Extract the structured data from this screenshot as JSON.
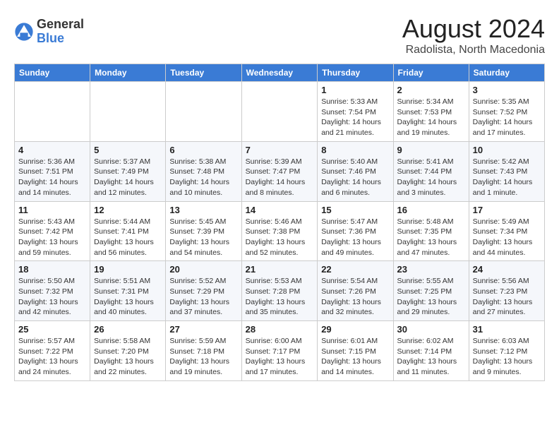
{
  "logo": {
    "general": "General",
    "blue": "Blue"
  },
  "title": "August 2024",
  "location": "Radolista, North Macedonia",
  "days_of_week": [
    "Sunday",
    "Monday",
    "Tuesday",
    "Wednesday",
    "Thursday",
    "Friday",
    "Saturday"
  ],
  "weeks": [
    [
      {
        "day": "",
        "detail": ""
      },
      {
        "day": "",
        "detail": ""
      },
      {
        "day": "",
        "detail": ""
      },
      {
        "day": "",
        "detail": ""
      },
      {
        "day": "1",
        "detail": "Sunrise: 5:33 AM\nSunset: 7:54 PM\nDaylight: 14 hours and 21 minutes."
      },
      {
        "day": "2",
        "detail": "Sunrise: 5:34 AM\nSunset: 7:53 PM\nDaylight: 14 hours and 19 minutes."
      },
      {
        "day": "3",
        "detail": "Sunrise: 5:35 AM\nSunset: 7:52 PM\nDaylight: 14 hours and 17 minutes."
      }
    ],
    [
      {
        "day": "4",
        "detail": "Sunrise: 5:36 AM\nSunset: 7:51 PM\nDaylight: 14 hours and 14 minutes."
      },
      {
        "day": "5",
        "detail": "Sunrise: 5:37 AM\nSunset: 7:49 PM\nDaylight: 14 hours and 12 minutes."
      },
      {
        "day": "6",
        "detail": "Sunrise: 5:38 AM\nSunset: 7:48 PM\nDaylight: 14 hours and 10 minutes."
      },
      {
        "day": "7",
        "detail": "Sunrise: 5:39 AM\nSunset: 7:47 PM\nDaylight: 14 hours and 8 minutes."
      },
      {
        "day": "8",
        "detail": "Sunrise: 5:40 AM\nSunset: 7:46 PM\nDaylight: 14 hours and 6 minutes."
      },
      {
        "day": "9",
        "detail": "Sunrise: 5:41 AM\nSunset: 7:44 PM\nDaylight: 14 hours and 3 minutes."
      },
      {
        "day": "10",
        "detail": "Sunrise: 5:42 AM\nSunset: 7:43 PM\nDaylight: 14 hours and 1 minute."
      }
    ],
    [
      {
        "day": "11",
        "detail": "Sunrise: 5:43 AM\nSunset: 7:42 PM\nDaylight: 13 hours and 59 minutes."
      },
      {
        "day": "12",
        "detail": "Sunrise: 5:44 AM\nSunset: 7:41 PM\nDaylight: 13 hours and 56 minutes."
      },
      {
        "day": "13",
        "detail": "Sunrise: 5:45 AM\nSunset: 7:39 PM\nDaylight: 13 hours and 54 minutes."
      },
      {
        "day": "14",
        "detail": "Sunrise: 5:46 AM\nSunset: 7:38 PM\nDaylight: 13 hours and 52 minutes."
      },
      {
        "day": "15",
        "detail": "Sunrise: 5:47 AM\nSunset: 7:36 PM\nDaylight: 13 hours and 49 minutes."
      },
      {
        "day": "16",
        "detail": "Sunrise: 5:48 AM\nSunset: 7:35 PM\nDaylight: 13 hours and 47 minutes."
      },
      {
        "day": "17",
        "detail": "Sunrise: 5:49 AM\nSunset: 7:34 PM\nDaylight: 13 hours and 44 minutes."
      }
    ],
    [
      {
        "day": "18",
        "detail": "Sunrise: 5:50 AM\nSunset: 7:32 PM\nDaylight: 13 hours and 42 minutes."
      },
      {
        "day": "19",
        "detail": "Sunrise: 5:51 AM\nSunset: 7:31 PM\nDaylight: 13 hours and 40 minutes."
      },
      {
        "day": "20",
        "detail": "Sunrise: 5:52 AM\nSunset: 7:29 PM\nDaylight: 13 hours and 37 minutes."
      },
      {
        "day": "21",
        "detail": "Sunrise: 5:53 AM\nSunset: 7:28 PM\nDaylight: 13 hours and 35 minutes."
      },
      {
        "day": "22",
        "detail": "Sunrise: 5:54 AM\nSunset: 7:26 PM\nDaylight: 13 hours and 32 minutes."
      },
      {
        "day": "23",
        "detail": "Sunrise: 5:55 AM\nSunset: 7:25 PM\nDaylight: 13 hours and 29 minutes."
      },
      {
        "day": "24",
        "detail": "Sunrise: 5:56 AM\nSunset: 7:23 PM\nDaylight: 13 hours and 27 minutes."
      }
    ],
    [
      {
        "day": "25",
        "detail": "Sunrise: 5:57 AM\nSunset: 7:22 PM\nDaylight: 13 hours and 24 minutes."
      },
      {
        "day": "26",
        "detail": "Sunrise: 5:58 AM\nSunset: 7:20 PM\nDaylight: 13 hours and 22 minutes."
      },
      {
        "day": "27",
        "detail": "Sunrise: 5:59 AM\nSunset: 7:18 PM\nDaylight: 13 hours and 19 minutes."
      },
      {
        "day": "28",
        "detail": "Sunrise: 6:00 AM\nSunset: 7:17 PM\nDaylight: 13 hours and 17 minutes."
      },
      {
        "day": "29",
        "detail": "Sunrise: 6:01 AM\nSunset: 7:15 PM\nDaylight: 13 hours and 14 minutes."
      },
      {
        "day": "30",
        "detail": "Sunrise: 6:02 AM\nSunset: 7:14 PM\nDaylight: 13 hours and 11 minutes."
      },
      {
        "day": "31",
        "detail": "Sunrise: 6:03 AM\nSunset: 7:12 PM\nDaylight: 13 hours and 9 minutes."
      }
    ]
  ]
}
